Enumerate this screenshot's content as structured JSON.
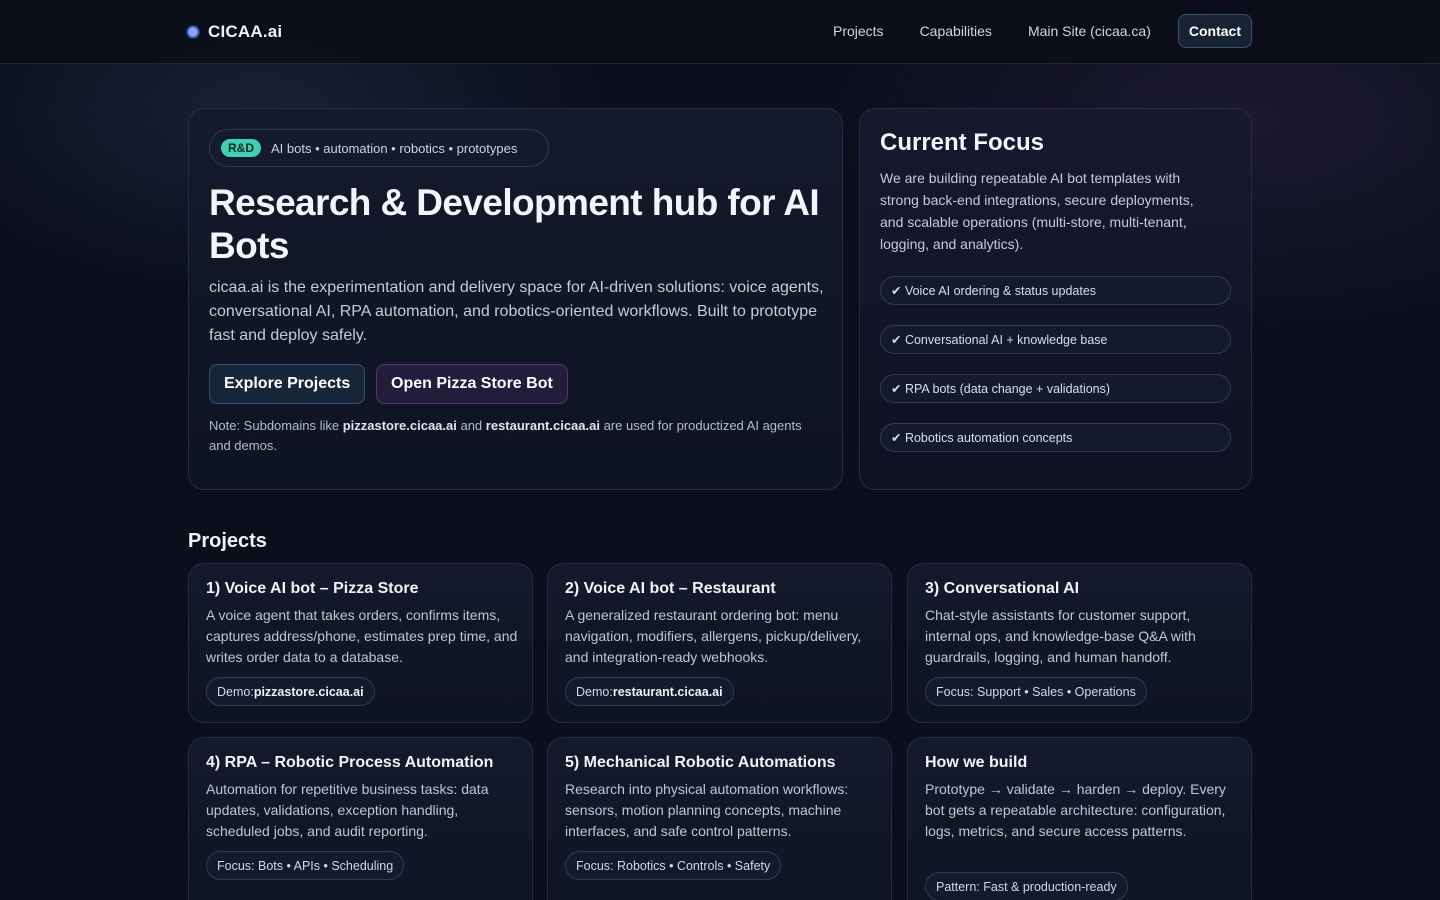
{
  "brand": {
    "name": "CICAA.ai"
  },
  "nav": {
    "items": [
      "Projects",
      "Capabilities",
      "Main Site (cicaa.ca)"
    ],
    "contact": "Contact"
  },
  "hero": {
    "badge": "R&D",
    "pill_text": "AI bots • automation • robotics • prototypes",
    "title": "Research & Development hub for AI Bots",
    "description": "cicaa.ai is the experimentation and delivery space for AI-driven solutions: voice agents, conversational AI, RPA automation, and robotics-oriented workflows. Built to prototype fast and deploy safely.",
    "btn_explore": "Explore Projects",
    "btn_pizza": "Open Pizza Store Bot",
    "note_prefix": "Note: Subdomains like ",
    "note_domain1": "pizzastore.cicaa.ai",
    "note_mid": " and ",
    "note_domain2": "restaurant.cicaa.ai",
    "note_suffix": " are used for productized AI agents and demos."
  },
  "focus": {
    "title": "Current Focus",
    "description": "We are building repeatable AI bot templates with strong back-end integrations, secure deployments, and scalable operations (multi-store, multi-tenant, logging, and analytics).",
    "items": [
      "✔ Voice AI ordering & status updates",
      "✔ Conversational AI + knowledge base",
      "✔ RPA bots (data change + validations)",
      "✔ Robotics automation concepts"
    ]
  },
  "projects": {
    "title": "Projects",
    "cards": [
      {
        "title": "1) Voice AI bot – Pizza Store",
        "description": "A voice agent that takes orders, confirms items, captures address/phone, estimates prep time, and writes order data to a database.",
        "tag_prefix": "Demo:",
        "tag_bold": "pizzastore.cicaa.ai"
      },
      {
        "title": "2) Voice AI bot – Restaurant",
        "description": "A generalized restaurant ordering bot: menu navigation, modifiers, allergens, pickup/delivery, and integration-ready webhooks.",
        "tag_prefix": "Demo:",
        "tag_bold": "restaurant.cicaa.ai"
      },
      {
        "title": "3) Conversational AI",
        "description": "Chat-style assistants for customer support, internal ops, and knowledge-base Q&A with guardrails, logging, and human handoff.",
        "tag_prefix": "Focus: Support • Sales • Operations",
        "tag_bold": ""
      },
      {
        "title": "4) RPA – Robotic Process Automation",
        "description": "Automation for repetitive business tasks: data updates, validations, exception handling, scheduled jobs, and audit reporting.",
        "tag_prefix": "Focus: Bots • APIs • Scheduling",
        "tag_bold": ""
      },
      {
        "title": "5) Mechanical Robotic Automations",
        "description": "Research into physical automation workflows: sensors, motion planning concepts, machine interfaces, and safe control patterns.",
        "tag_prefix": "Focus: Robotics • Controls • Safety",
        "tag_bold": ""
      },
      {
        "title": "How we build",
        "description": "Prototype → validate → harden → deploy. Every bot gets a repeatable architecture: configuration, logs, metrics, and secure access patterns.",
        "tag_prefix": "Pattern: Fast & production-ready",
        "tag_bold": ""
      }
    ]
  }
}
